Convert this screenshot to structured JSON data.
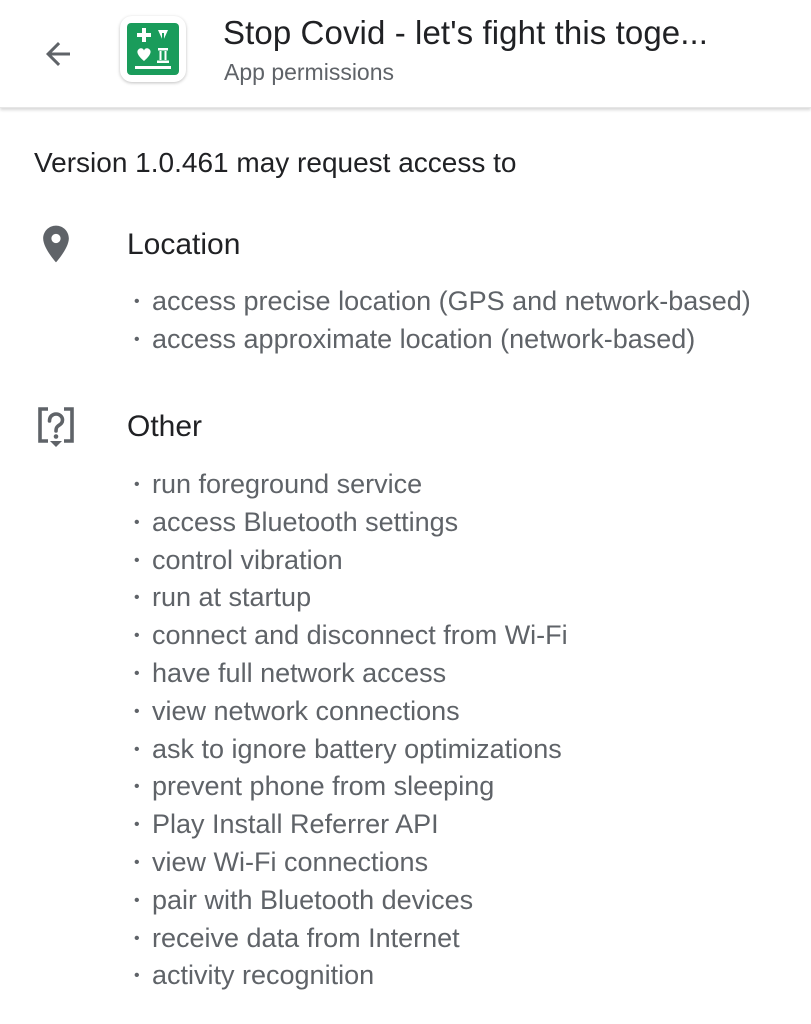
{
  "header": {
    "title": "Stop Covid - let's fight this toge...",
    "subtitle": "App permissions",
    "back_icon": "arrow-back-icon",
    "app_icon": "stop-covid-app-icon",
    "app_icon_color": "#1a9c5b"
  },
  "intro": "Version 1.0.461 may request access to",
  "bullet": "•",
  "groups": [
    {
      "icon": "location-pin-icon",
      "title": "Location",
      "items": [
        "access precise location (GPS and network-based)",
        "access approximate location (network-based)"
      ]
    },
    {
      "icon": "question-box-icon",
      "title": "Other",
      "items": [
        "run foreground service",
        "access Bluetooth settings",
        "control vibration",
        "run at startup",
        "connect and disconnect from Wi-Fi",
        "have full network access",
        "view network connections",
        "ask to ignore battery optimizations",
        "prevent phone from sleeping",
        "Play Install Referrer API",
        "view Wi-Fi connections",
        "pair with Bluetooth devices",
        "receive data from Internet",
        "activity recognition"
      ]
    }
  ]
}
